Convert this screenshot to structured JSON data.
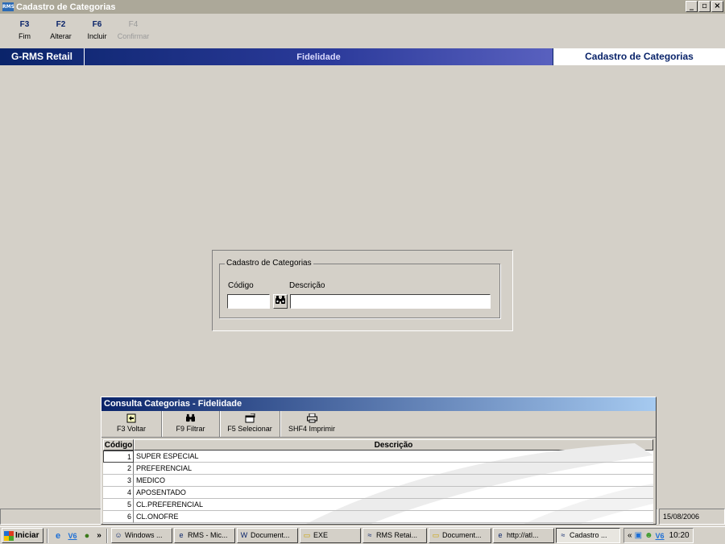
{
  "window": {
    "title": "Cadastro de Categorias",
    "app_icon": "RMS",
    "controls": [
      "_",
      "▫",
      "×"
    ]
  },
  "fkeys": [
    {
      "key": "F3",
      "label": "Fim",
      "enabled": true
    },
    {
      "key": "F2",
      "label": "Alterar",
      "enabled": true
    },
    {
      "key": "F6",
      "label": "Incluir",
      "enabled": true
    },
    {
      "key": "F4",
      "label": "Confirmar",
      "enabled": false
    }
  ],
  "banner": {
    "product": "G-RMS Retail",
    "module": "Fidelidade",
    "screen": "Cadastro de Categorias"
  },
  "form": {
    "group_title": "Cadastro de Categorias",
    "codigo_label": "Código",
    "descricao_label": "Descrição",
    "codigo_value": "",
    "descricao_value": ""
  },
  "consulta": {
    "title": "Consulta Categorias - Fidelidade",
    "toolbar": [
      {
        "label": "F3 Voltar",
        "icon": "back-icon"
      },
      {
        "label": "F9 Filtrar",
        "icon": "binoculars-icon"
      },
      {
        "label": "F5 Selecionar",
        "icon": "select-icon"
      },
      {
        "label": "SHF4 Imprimir",
        "icon": "printer-icon"
      }
    ],
    "columns": [
      "Código",
      "Descrição"
    ],
    "rows": [
      {
        "codigo": "1",
        "descricao": "SUPER ESPECIAL"
      },
      {
        "codigo": "2",
        "descricao": "PREFERENCIAL"
      },
      {
        "codigo": "3",
        "descricao": "MEDICO"
      },
      {
        "codigo": "4",
        "descricao": "APOSENTADO"
      },
      {
        "codigo": "5",
        "descricao": "CL.PREFERENCIAL"
      },
      {
        "codigo": "6",
        "descricao": "CL.ONOFRE"
      }
    ]
  },
  "status": {
    "date": "15/08/2006"
  },
  "taskbar": {
    "start_label": "Iniciar",
    "chevron": "»",
    "tasks": [
      {
        "label": "Windows ...",
        "icon": "users-icon"
      },
      {
        "label": "RMS - Mic...",
        "icon": "ie-icon"
      },
      {
        "label": "Document...",
        "icon": "word-icon"
      },
      {
        "label": "EXE",
        "icon": "folder-icon"
      },
      {
        "label": "RMS Retai...",
        "icon": "rms-icon"
      },
      {
        "label": "Document...",
        "icon": "folder-icon"
      },
      {
        "label": "http://atl...",
        "icon": "ie-icon"
      },
      {
        "label": "Cadastro ...",
        "icon": "rms-icon",
        "active": true
      }
    ],
    "tray_chevron": "«",
    "clock": "10:20"
  },
  "colors": {
    "titlebar": "#aca899",
    "banner_dark": "#0a246a",
    "face": "#d4d0c8"
  }
}
